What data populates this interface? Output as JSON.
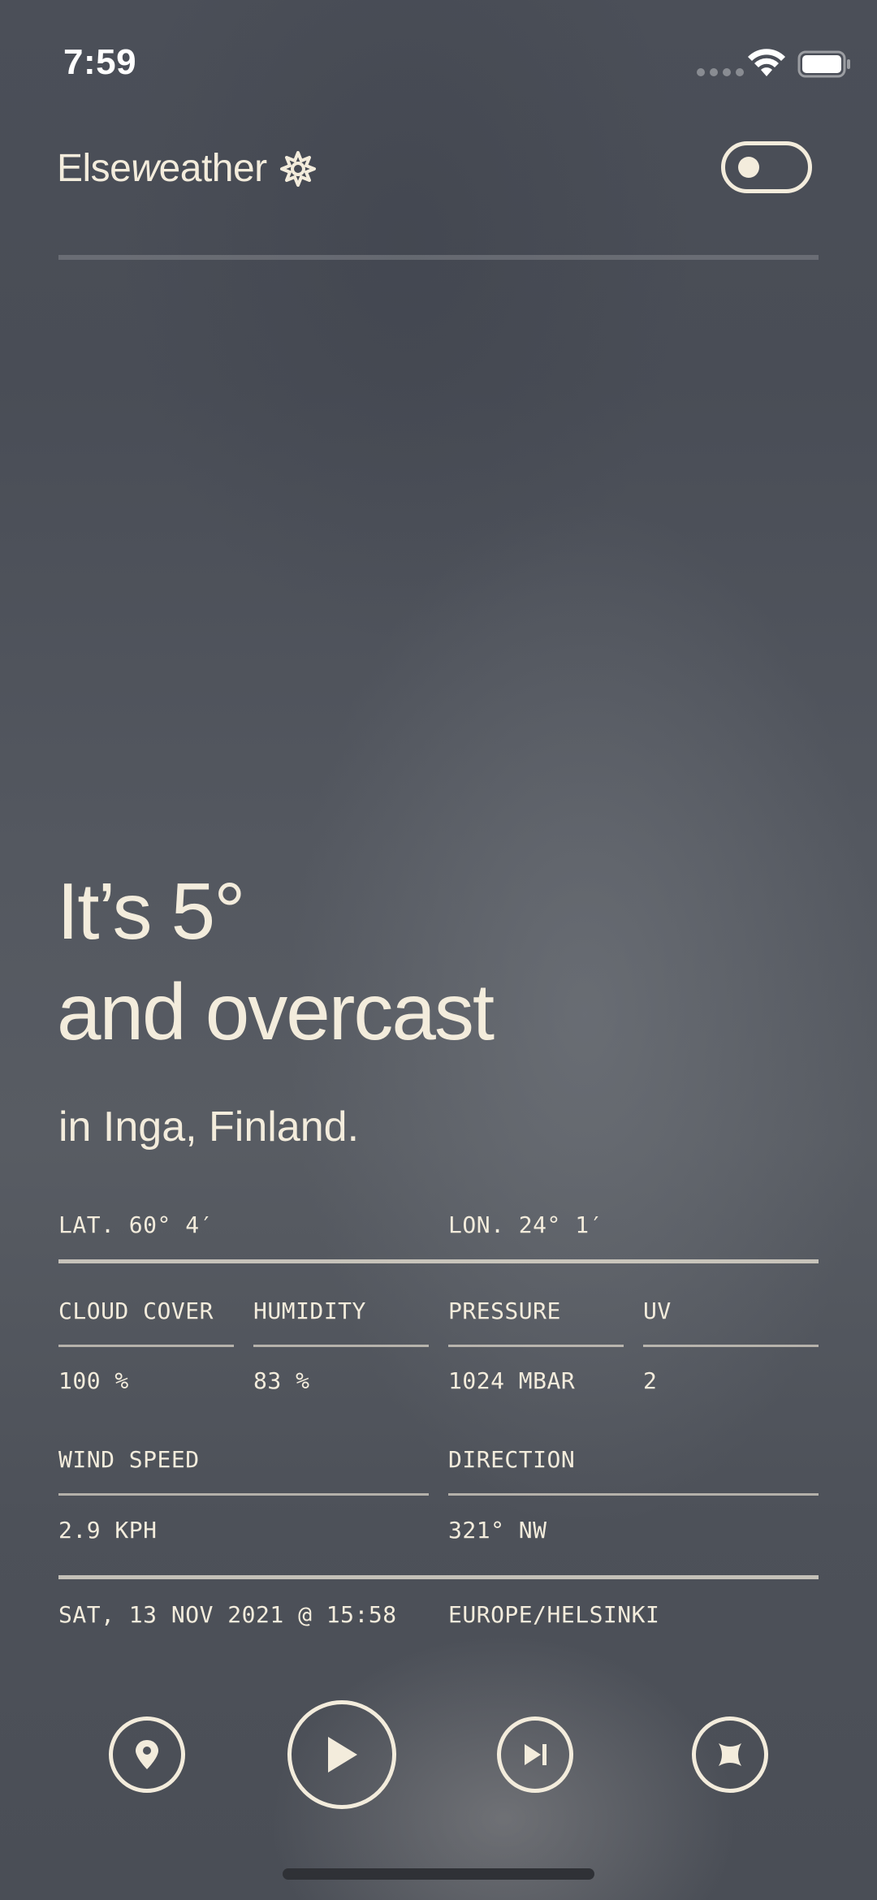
{
  "status_bar": {
    "time": "7:59"
  },
  "header": {
    "app_name_prefix": "Else",
    "app_name_italic": "w",
    "app_name_suffix": "eather"
  },
  "headline": {
    "line1": "It’s 5°",
    "line2": "and overcast",
    "location": "in Inga, Finland."
  },
  "coordinates": {
    "lat": "LAT. 60° 4′",
    "lon": "LON. 24° 1′"
  },
  "metrics": [
    {
      "label": "CLOUD COVER",
      "value": "100 %"
    },
    {
      "label": "HUMIDITY",
      "value": "83 %"
    },
    {
      "label": "PRESSURE",
      "value": "1024 MBAR"
    },
    {
      "label": "UV",
      "value": "2"
    }
  ],
  "wind": {
    "speed_label": "WIND SPEED",
    "speed_value": "2.9 KPH",
    "direction_label": "DIRECTION",
    "direction_value": "321° NW"
  },
  "footer": {
    "datetime": "SAT, 13 NOV 2021 @ 15:58",
    "timezone": "EUROPE/HELSINKI"
  },
  "controls": {
    "icons": [
      "location-pin-icon",
      "play-icon",
      "skip-forward-icon",
      "sparkle-icon"
    ]
  },
  "colors": {
    "foreground": "#f3ecdc",
    "background": "#50545c"
  }
}
